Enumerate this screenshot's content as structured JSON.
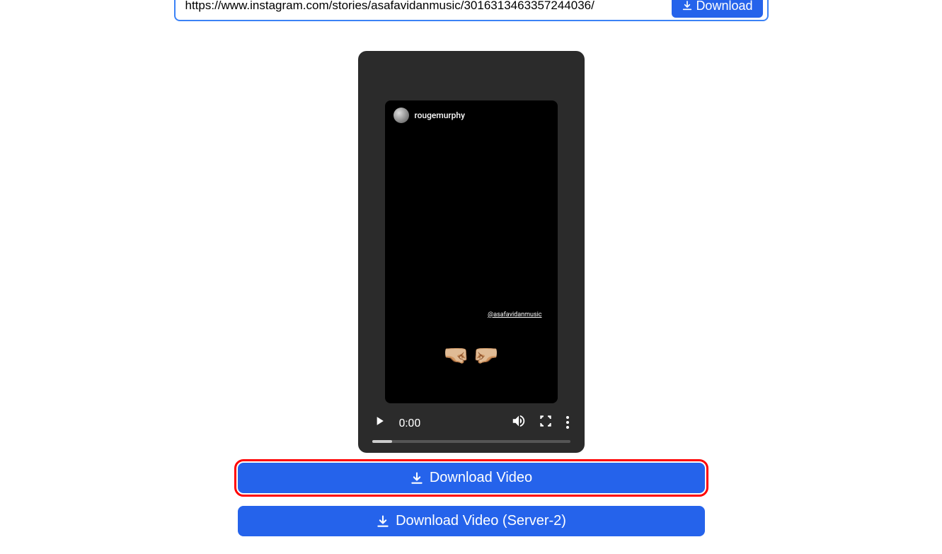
{
  "url_input": {
    "value": "https://www.instagram.com/stories/asafavidanmusic/3016313463357244036/"
  },
  "top_button": {
    "label": "Download"
  },
  "story": {
    "username": "rougemurphy",
    "mention": "@asafavidanmusic",
    "emoji_left": "🤜🏼",
    "emoji_right": "🤛🏼"
  },
  "player": {
    "time": "0:00"
  },
  "buttons": {
    "download_video": "Download Video",
    "download_video_server2": "Download Video (Server-2)"
  }
}
